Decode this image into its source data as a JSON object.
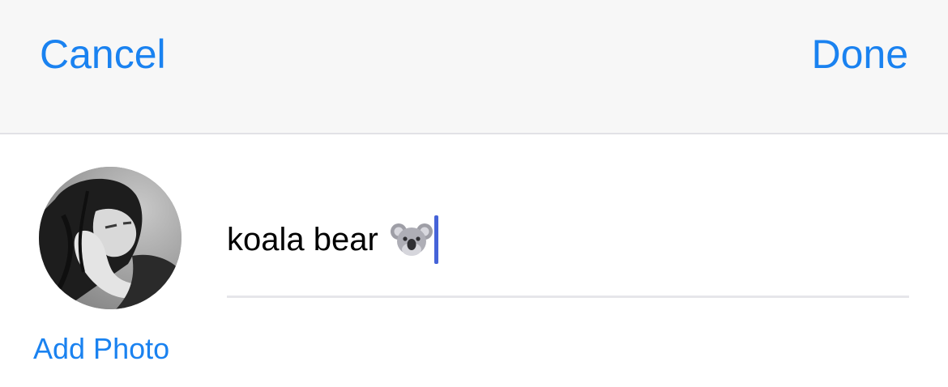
{
  "nav": {
    "cancel_label": "Cancel",
    "done_label": "Done"
  },
  "profile": {
    "add_photo_label": "Add Photo",
    "avatar_icon": "profile-photo",
    "name_value": "koala bear ",
    "name_emoji_icon": "koala-emoji"
  },
  "colors": {
    "accent": "#1a82f0",
    "caret": "#4563d8",
    "nav_background": "#f7f7f7",
    "divider": "#e6e6ea"
  }
}
